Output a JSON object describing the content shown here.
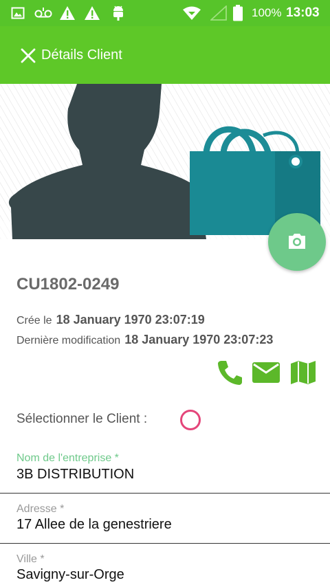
{
  "status_bar": {
    "battery": "100%",
    "time": "13:03"
  },
  "header": {
    "title": "Détails Client",
    "close_icon": "close-icon"
  },
  "client": {
    "code": "CU1802-0249",
    "created_label": "Crée le",
    "created_value": "18 January 1970 23:07:19",
    "modified_label": "Dernière modification",
    "modified_value": "18 January 1970 23:07:23"
  },
  "actions": {
    "phone_icon": "phone-icon",
    "email_icon": "email-icon",
    "map_icon": "map-icon",
    "camera_icon": "camera-icon"
  },
  "select": {
    "label": "Sélectionner le Client :"
  },
  "fields": {
    "company": {
      "label": "Nom de l'entreprise *",
      "value": "3B DISTRIBUTION"
    },
    "address": {
      "label": "Adresse *",
      "value": "17 Allee de la genestriere"
    },
    "city": {
      "label": "Ville *",
      "value": "Savigny-sur-Orge"
    }
  },
  "colors": {
    "app_bar": "#5ec828",
    "status_bar": "#57c42a",
    "accent": "#6ec98a",
    "radio": "#e4457a",
    "icon_green": "#5cb82a"
  }
}
